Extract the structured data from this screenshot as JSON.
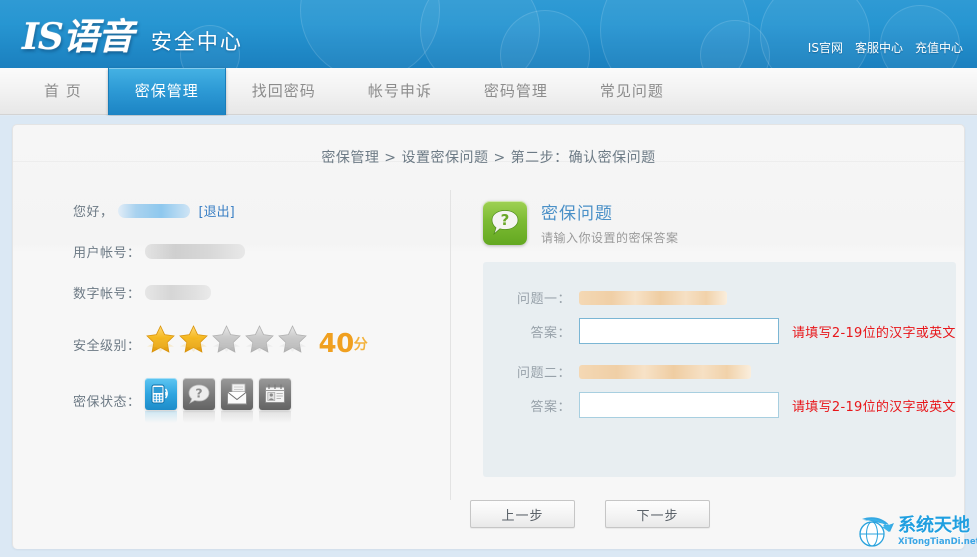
{
  "header": {
    "logo_main": "IS语音",
    "logo_sub": "安全中心",
    "top_links": [
      {
        "label": "IS官网"
      },
      {
        "label": "客服中心"
      },
      {
        "label": "充值中心"
      }
    ]
  },
  "nav": {
    "items": [
      {
        "label": "首 页",
        "active": false
      },
      {
        "label": "密保管理",
        "active": true
      },
      {
        "label": "找回密码",
        "active": false
      },
      {
        "label": "帐号申诉",
        "active": false
      },
      {
        "label": "密码管理",
        "active": false
      },
      {
        "label": "常见问题",
        "active": false
      }
    ]
  },
  "breadcrumb": {
    "text": "密保管理  >  设置密保问题  >  第二步：确认密保问题"
  },
  "account": {
    "greeting_label": "您好，",
    "logout_label": "[退出]",
    "user_account_label": "用户帐号：",
    "number_account_label": "数字帐号：",
    "security_level_label": "安全级别：",
    "score": "40",
    "score_unit": "分",
    "stars_filled": 2,
    "stars_total": 5,
    "security_status_label": "密保状态：",
    "status_icons": [
      {
        "name": "mobile-phone-icon",
        "active": true
      },
      {
        "name": "question-mark-icon",
        "active": false
      },
      {
        "name": "envelope-mail-icon",
        "active": false
      },
      {
        "name": "id-card-icon",
        "active": false
      }
    ]
  },
  "question_panel": {
    "title": "密保问题",
    "description": "请输入你设置的密保答案",
    "rows": [
      {
        "question_label": "问题一：",
        "answer_label": "答案：",
        "answer_value": "",
        "hint": "请填写2-19位的汉字或英文",
        "focused": true
      },
      {
        "question_label": "问题二：",
        "answer_label": "答案：",
        "answer_value": "",
        "hint": "请填写2-19位的汉字或英文",
        "focused": false
      }
    ]
  },
  "buttons": {
    "prev": "上一步",
    "next": "下一步"
  },
  "watermark": {
    "cn": "系统天地",
    "en": "XiTongTianDi.net"
  },
  "colors": {
    "header_blue": "#2796d2",
    "active_tab_blue": "#2e9bd6",
    "accent_link": "#3a7fc4",
    "score_orange": "#f0a020",
    "hint_red": "#e8161a",
    "panel_bg": "#f7f7f7",
    "form_bg": "#e8eef1",
    "outer_bg": "#dbe8f4"
  }
}
